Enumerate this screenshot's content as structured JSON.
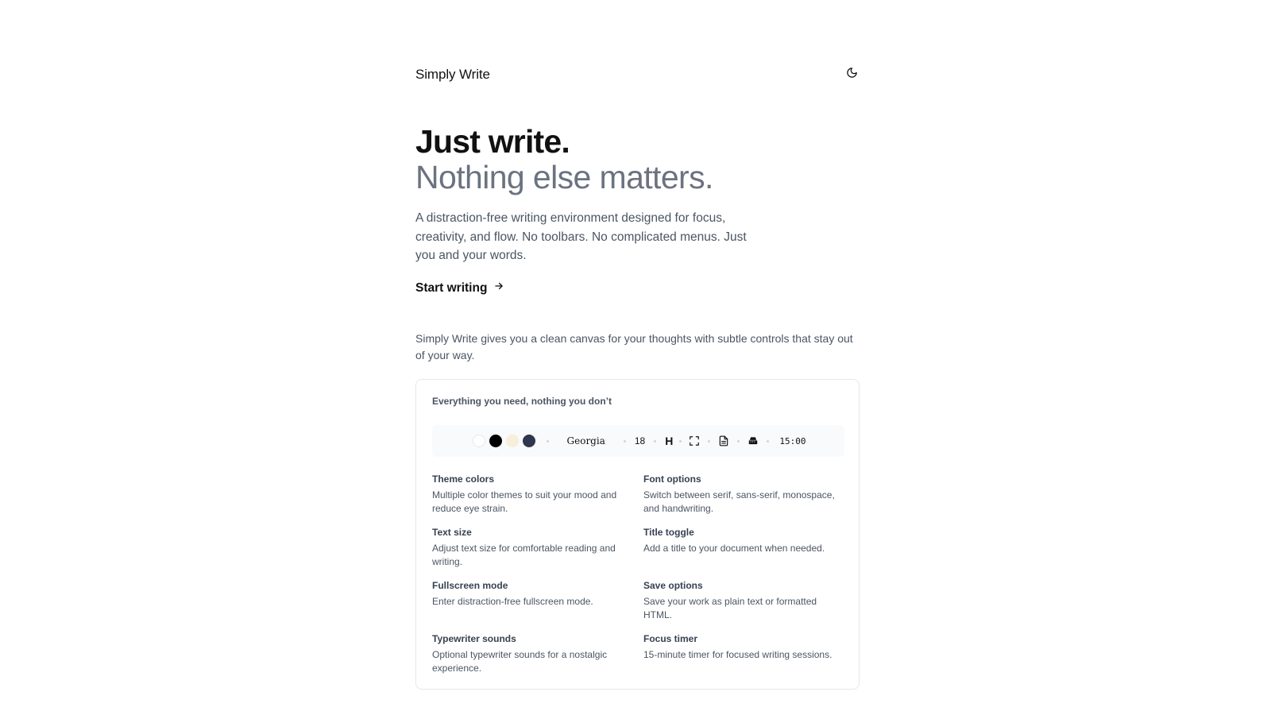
{
  "header": {
    "brand": "Simply Write",
    "theme_toggle_icon": "moon-icon"
  },
  "hero": {
    "title": "Just write.",
    "subtitle": "Nothing else matters.",
    "description": "A distraction-free writing environment designed for focus, creativity, and flow. No toolbars. No complicated menus. Just you and your words.",
    "cta_label": "Start writing",
    "cta_icon": "arrow-right-icon"
  },
  "intro": "Simply Write gives you a clean canvas for your thoughts with subtle controls that stay out of your way.",
  "card": {
    "title": "Everything you need, nothing you don’t",
    "toolbar": {
      "swatches": [
        {
          "name": "white",
          "color": "#ffffff"
        },
        {
          "name": "black",
          "color": "#000000"
        },
        {
          "name": "cream",
          "color": "#f5efdc"
        },
        {
          "name": "navy",
          "color": "#2e3650"
        }
      ],
      "font": "Georgia",
      "size": "18",
      "title_toggle": "H",
      "fullscreen_icon": "fullscreen-icon",
      "save_icon": "document-icon",
      "sound_icon": "typewriter-icon",
      "timer": "15:00"
    },
    "features": [
      {
        "title": "Theme colors",
        "desc": "Multiple color themes to suit your mood and reduce eye strain."
      },
      {
        "title": "Font options",
        "desc": "Switch between serif, sans-serif, monospace, and handwriting."
      },
      {
        "title": "Text size",
        "desc": "Adjust text size for comfortable reading and writing."
      },
      {
        "title": "Title toggle",
        "desc": "Add a title to your document when needed."
      },
      {
        "title": "Fullscreen mode",
        "desc": "Enter distraction-free fullscreen mode."
      },
      {
        "title": "Save options",
        "desc": "Save your work as plain text or formatted HTML."
      },
      {
        "title": "Typewriter sounds",
        "desc": "Optional typewriter sounds for a nostalgic experience."
      },
      {
        "title": "Focus timer",
        "desc": "15-minute timer for focused writing sessions."
      }
    ]
  }
}
